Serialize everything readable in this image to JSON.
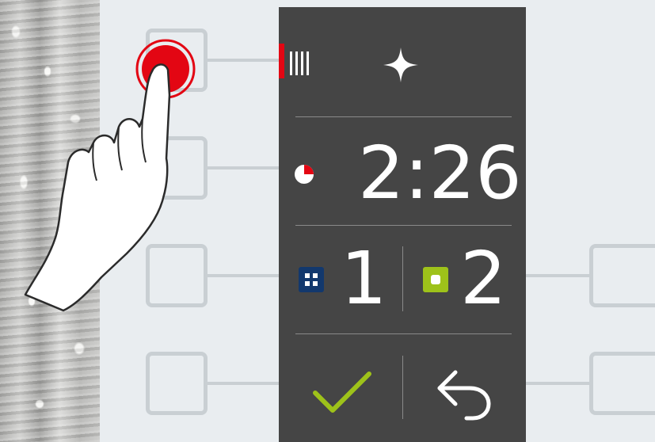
{
  "timer": {
    "value": "2:26",
    "progress": 0.25
  },
  "zones": {
    "zone1": "1",
    "zone2": "2"
  },
  "colors": {
    "panel": "#454545",
    "background": "#e9edf0",
    "active_indicator": "#e30613",
    "timer_fill": "#e30613",
    "zone1_icon": "#12386d",
    "zone2_icon": "#9ec21a",
    "confirm": "#9ec21a",
    "slot_outline": "#c9cfd3"
  },
  "icons": {
    "power_level": "power-level-bars-icon",
    "boost": "sparkle-icon",
    "timer": "timer-pie-icon",
    "zone1": "zone-grid-icon",
    "zone2": "zone-single-icon",
    "confirm": "checkmark-icon",
    "back": "back-arrow-icon",
    "finger": "finger-press-icon"
  }
}
